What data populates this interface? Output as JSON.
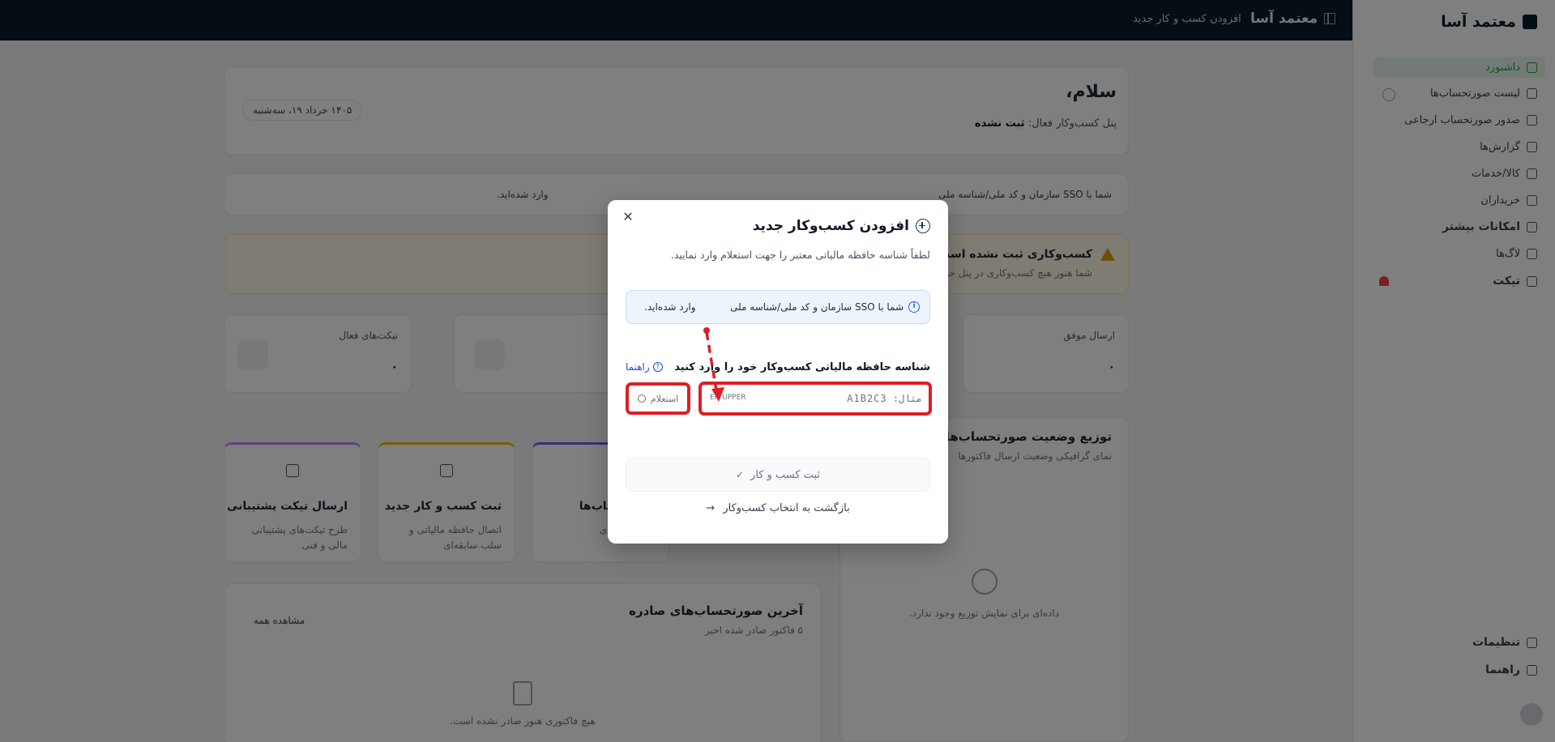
{
  "topbar": {
    "brand": "معتمد آسا",
    "breadcrumb": "افزودن کسب و کار جدید"
  },
  "sidebar": {
    "logo": "معتمد آسا",
    "items": [
      {
        "label": "داشبورد",
        "active": true
      },
      {
        "label": "لیست صورتحساب‌ها"
      },
      {
        "label": "صدور صورتحساب ارجاعی"
      },
      {
        "label": "گزارش‌ها"
      },
      {
        "label": "کالا/خدمات"
      },
      {
        "label": "خریداران"
      },
      {
        "label": "امکانات بیشتر",
        "bold": true
      },
      {
        "label": "لاگ‌ها"
      },
      {
        "label": "تیکت",
        "bold": true
      },
      {
        "label": "تنظیمات"
      },
      {
        "label": "راهنما"
      }
    ]
  },
  "dashboard": {
    "greeting": "سلام،",
    "active_business_label": "پنل کسب‌وکار فعال:",
    "active_business_value": "ثبت نشده",
    "date": "۱۴۰۵ خرداد ۱۹، سه‌شنبه",
    "sso_notice_right": "شما با SSO سازمان و کد ملی/شناسه ملی",
    "sso_notice_left": "وارد شده‌اید.",
    "warning_title": "کسب‌وکاری ثبت نشده است!",
    "warning_text": "شما هنوز هیچ کسب‌وکاری در پنل خود",
    "stats": [
      {
        "label": "ارسال موفق",
        "value": "۰"
      },
      {
        "label": "تیکت‌های فعال",
        "value": "۰"
      }
    ],
    "actions": [
      {
        "title": "ارسال تیکت پشتیبانی",
        "desc": "طرح تیکت‌های پشتیبانی مالی و فنی"
      },
      {
        "title": "ثبت کسب و کار جدید",
        "desc": "اتصال حافظه مالیاتی و سلب سابقه‌ای"
      },
      {
        "title": "صورتحساب‌ها",
        "desc": "ری فاکتورهای"
      }
    ],
    "chart_title": "توزیع وضعیت صورتحساب‌ها",
    "chart_subtitle": "نمای گرافیکی وضعیت ارسال فاکتورها",
    "chart_empty": "داده‌ای برای نمایش توزیع وجود ندارد.",
    "recent_title": "آخرین صورتحساب‌های صادره",
    "recent_subtitle": "۵ فاکتور صادر شده اخیر",
    "view_all": "مشاهده همه",
    "recent_empty": "هیچ فاکتوری هنوز صادر نشده است."
  },
  "modal": {
    "title": "افزودن کسب‌وکار جدید",
    "subtitle": "لطفاً شناسه حافظه مالیاتی معتبر را جهت استعلام وارد نمایید.",
    "sso_right": "شما با SSO سازمان و کد ملی/شناسه ملی",
    "sso_left": "وارد شده‌اید.",
    "field_label": "شناسه حافظه مالیاتی کسب‌وکار خود را وارد کنید",
    "help_label": "راهنما",
    "input_placeholder": "مثال: A1B2C3",
    "input_hint": "EN UPPER",
    "inquiry_label": "استعلام",
    "register_label": "ثبت کسب و کار",
    "back_label": "بازگشت به انتخاب کسب‌وکار",
    "close_icon": "close-icon"
  },
  "colors": {
    "highlight": "#dc1f26",
    "accent": "#0b3a53",
    "topbar": "#0b1d2b"
  }
}
